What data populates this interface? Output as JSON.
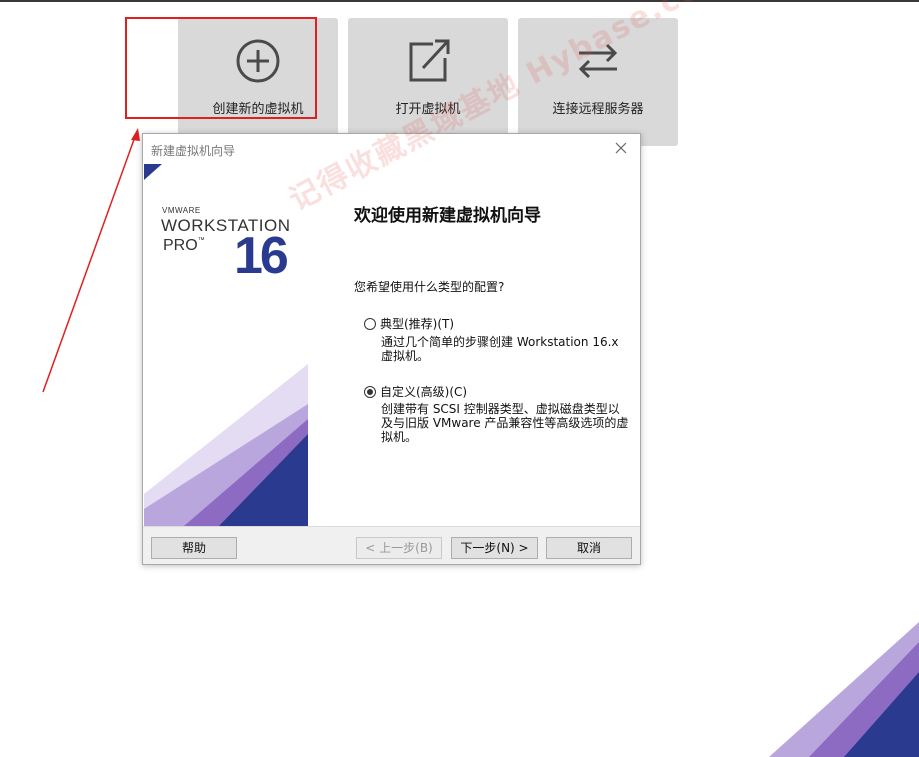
{
  "home_tiles": [
    {
      "label": "创建新的虚拟机",
      "icon": "plus-circle-icon"
    },
    {
      "label": "打开虚拟机",
      "icon": "open-external-icon"
    },
    {
      "label": "连接远程服务器",
      "icon": "swap-arrows-icon"
    }
  ],
  "wizard": {
    "title": "新建虚拟机向导",
    "banner": {
      "vendor": "VMWARE",
      "product": "WORKSTATION",
      "edition": "PRO",
      "trademark": "™",
      "version": "16"
    },
    "heading": "欢迎使用新建虚拟机向导",
    "question": "您希望使用什么类型的配置?",
    "options": [
      {
        "label": "典型(推荐)(T)",
        "description": "通过几个简单的步骤创建 Workstation 16.x 虚拟机。",
        "selected": false
      },
      {
        "label": "自定义(高级)(C)",
        "description": "创建带有 SCSI 控制器类型、虚拟磁盘类型以及与旧版 VMware 产品兼容性等高级选项的虚拟机。",
        "selected": true
      }
    ],
    "buttons": {
      "help": "帮助",
      "back": "< 上一步(B)",
      "next": "下一步(N) >",
      "cancel": "取消"
    }
  },
  "watermark": "记得收藏黑域基地 Hybase.com",
  "colors": {
    "accent_blue": "#2a3a8f",
    "accent_purple": "#8e6bc2",
    "highlight_red": "#e02020",
    "tile_bg": "#d9d9d9"
  }
}
